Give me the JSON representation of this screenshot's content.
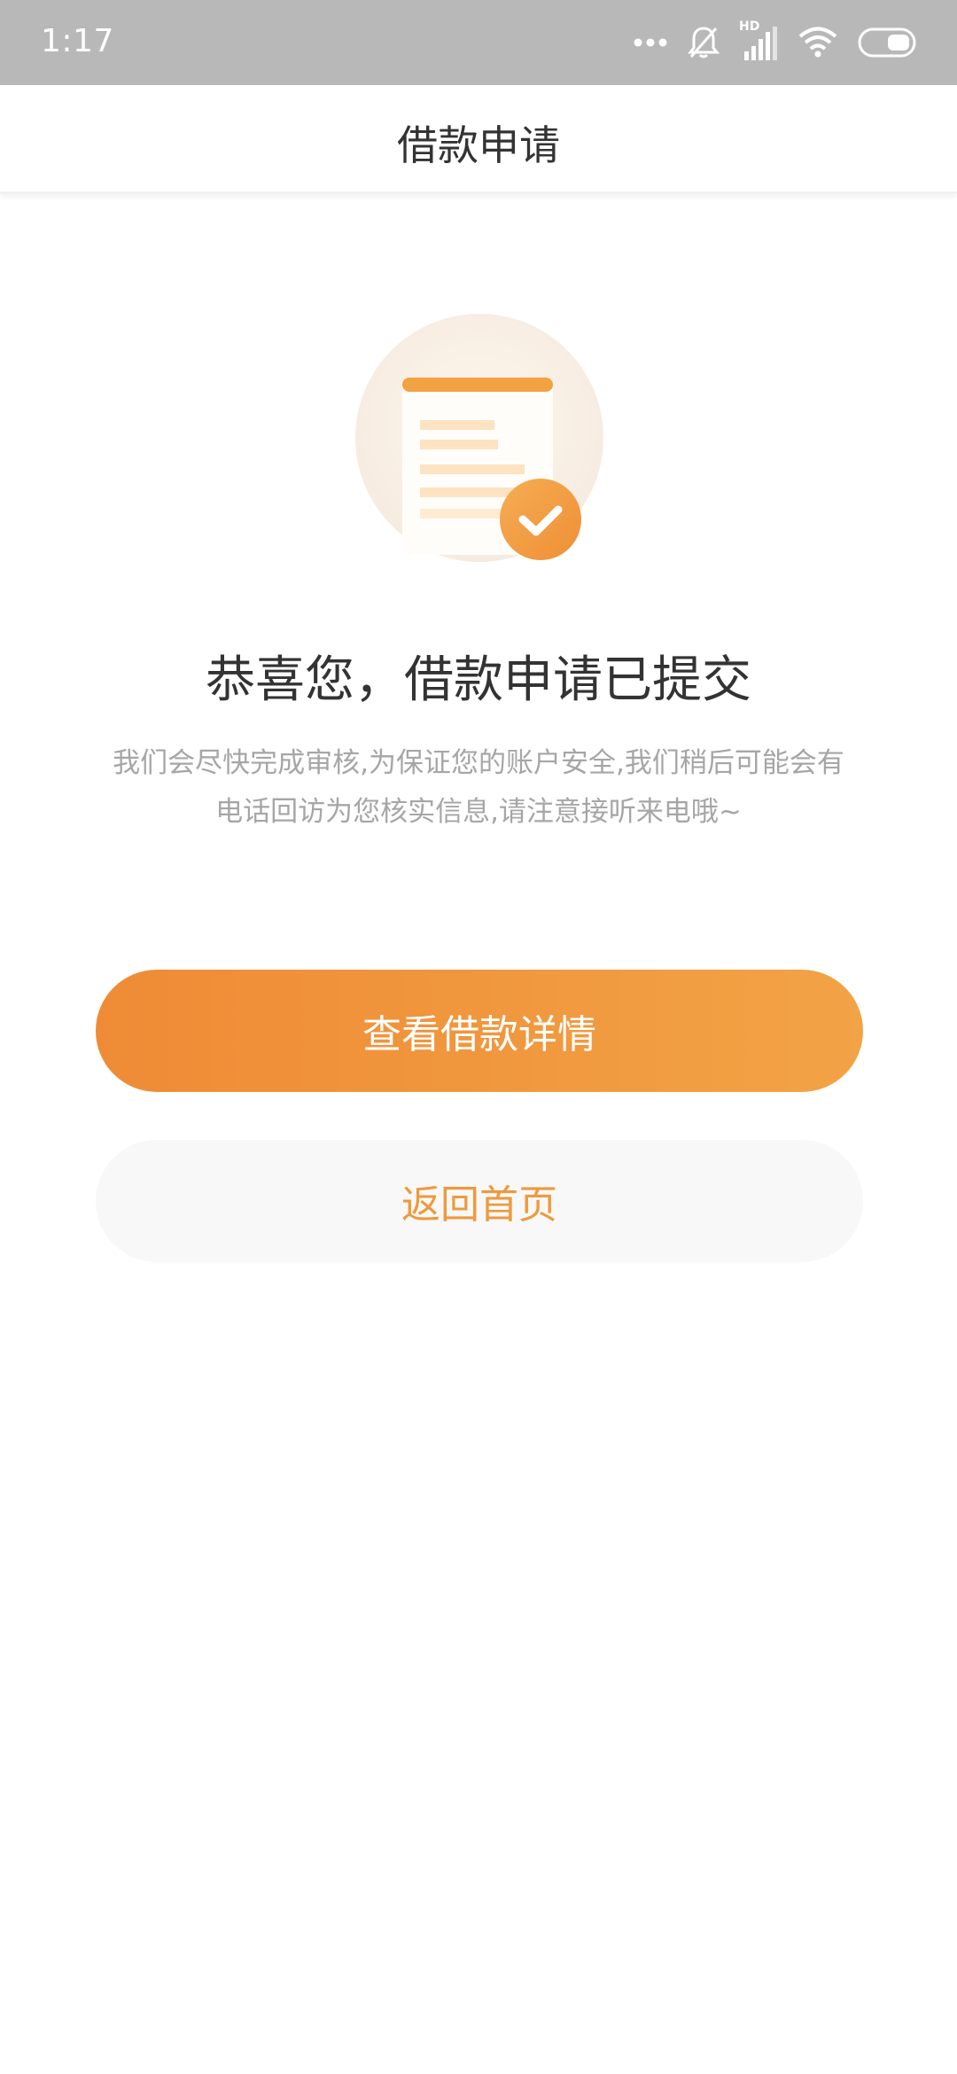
{
  "status_bar": {
    "time": "1:17",
    "icons": [
      "more-dots-icon",
      "mute-bell-icon",
      "hd-signal-icon",
      "wifi-icon",
      "battery-icon"
    ],
    "hd_label": "HD"
  },
  "nav": {
    "title": "借款申请"
  },
  "illustration": {
    "icon": "document-check-icon",
    "accent_color": "#f29a3b"
  },
  "main": {
    "headline": "恭喜您，借款申请已提交",
    "description_lines": [
      "我们会尽快完成审核,为保证您的账户安全,我们稍后可能会有",
      "电话回访为您核实信息,请注意接听来电哦~"
    ]
  },
  "actions": {
    "primary_label": "查看借款详情",
    "secondary_label": "返回首页"
  },
  "colors": {
    "primary_gradient_start": "#ef8b36",
    "primary_gradient_end": "#f2a345",
    "secondary_text": "#ee9a3c",
    "status_bar_bg": "#b8b8b8"
  }
}
